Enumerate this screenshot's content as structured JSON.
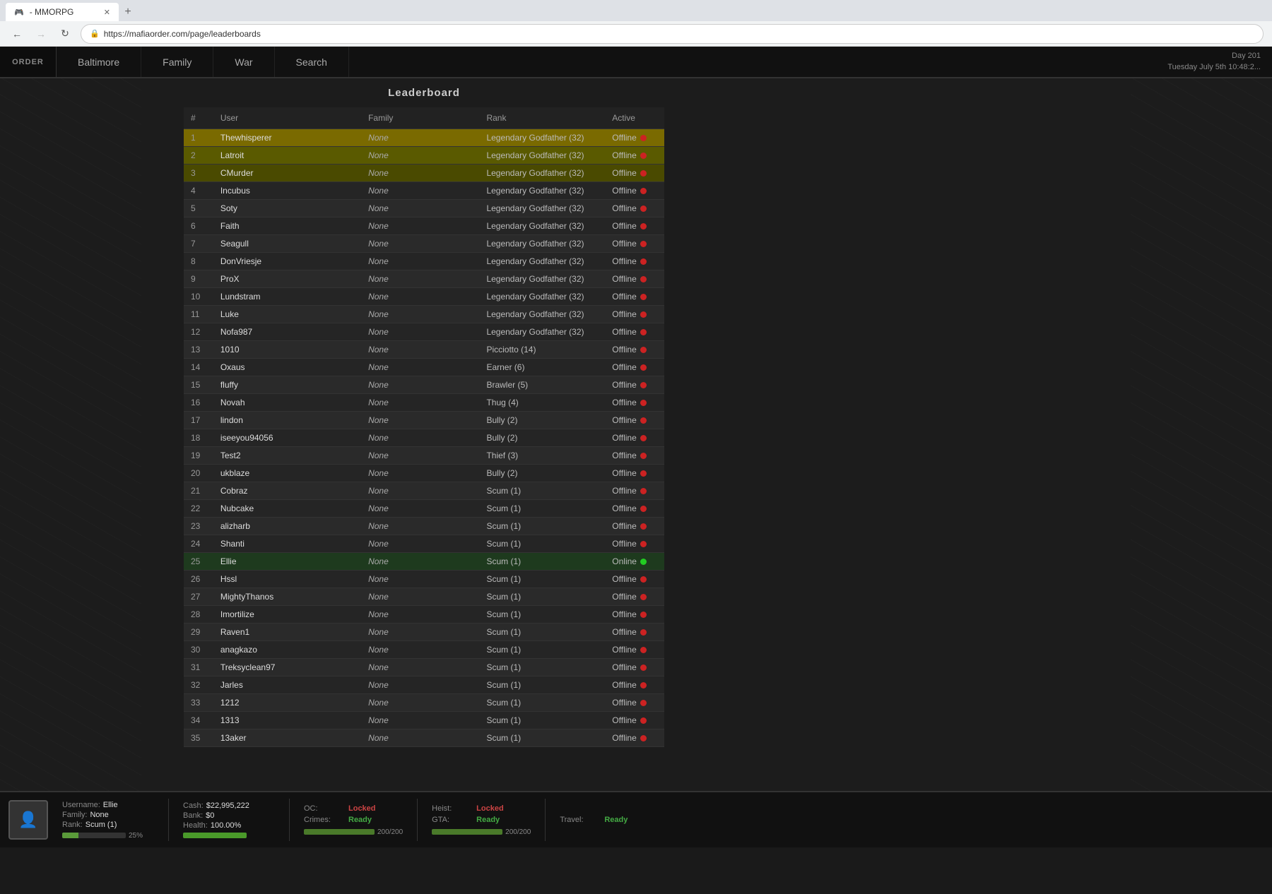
{
  "browser": {
    "tab_title": "- MMORPG",
    "url": "https://mafiaorder.com/page/leaderboards"
  },
  "navbar": {
    "logo": "ORDER",
    "items": [
      "Baltimore",
      "Family",
      "War",
      "Search"
    ],
    "datetime_line1": "Day 201",
    "datetime_line2": "Tuesday July 5th 10:48:2..."
  },
  "leaderboard": {
    "title": "Leaderboard",
    "columns": [
      "#",
      "User",
      "Family",
      "Rank",
      "Active"
    ],
    "rows": [
      {
        "pos": 1,
        "user": "Thewhisperer",
        "family": "None",
        "rank": "Legendary Godfather (32)",
        "active": "Offline",
        "online": false,
        "css_class": "rank-1"
      },
      {
        "pos": 2,
        "user": "Latroit",
        "family": "None",
        "rank": "Legendary Godfather (32)",
        "active": "Offline",
        "online": false,
        "css_class": "rank-2"
      },
      {
        "pos": 3,
        "user": "CMurder",
        "family": "None",
        "rank": "Legendary Godfather (32)",
        "active": "Offline",
        "online": false,
        "css_class": "rank-3"
      },
      {
        "pos": 4,
        "user": "Incubus",
        "family": "None",
        "rank": "Legendary Godfather (32)",
        "active": "Offline",
        "online": false,
        "css_class": ""
      },
      {
        "pos": 5,
        "user": "Soty",
        "family": "None",
        "rank": "Legendary Godfather (32)",
        "active": "Offline",
        "online": false,
        "css_class": ""
      },
      {
        "pos": 6,
        "user": "Faith",
        "family": "None",
        "rank": "Legendary Godfather (32)",
        "active": "Offline",
        "online": false,
        "css_class": ""
      },
      {
        "pos": 7,
        "user": "Seagull",
        "family": "None",
        "rank": "Legendary Godfather (32)",
        "active": "Offline",
        "online": false,
        "css_class": ""
      },
      {
        "pos": 8,
        "user": "DonVriesje",
        "family": "None",
        "rank": "Legendary Godfather (32)",
        "active": "Offline",
        "online": false,
        "css_class": ""
      },
      {
        "pos": 9,
        "user": "ProX",
        "family": "None",
        "rank": "Legendary Godfather (32)",
        "active": "Offline",
        "online": false,
        "css_class": ""
      },
      {
        "pos": 10,
        "user": "Lundstram",
        "family": "None",
        "rank": "Legendary Godfather (32)",
        "active": "Offline",
        "online": false,
        "css_class": ""
      },
      {
        "pos": 11,
        "user": "Luke",
        "family": "None",
        "rank": "Legendary Godfather (32)",
        "active": "Offline",
        "online": false,
        "css_class": ""
      },
      {
        "pos": 12,
        "user": "Nofa987",
        "family": "None",
        "rank": "Legendary Godfather (32)",
        "active": "Offline",
        "online": false,
        "css_class": ""
      },
      {
        "pos": 13,
        "user": "1010",
        "family": "None",
        "rank": "Picciotto (14)",
        "active": "Offline",
        "online": false,
        "css_class": ""
      },
      {
        "pos": 14,
        "user": "Oxaus",
        "family": "None",
        "rank": "Earner (6)",
        "active": "Offline",
        "online": false,
        "css_class": ""
      },
      {
        "pos": 15,
        "user": "fluffy",
        "family": "None",
        "rank": "Brawler (5)",
        "active": "Offline",
        "online": false,
        "css_class": ""
      },
      {
        "pos": 16,
        "user": "Novah",
        "family": "None",
        "rank": "Thug (4)",
        "active": "Offline",
        "online": false,
        "css_class": ""
      },
      {
        "pos": 17,
        "user": "lindon",
        "family": "None",
        "rank": "Bully (2)",
        "active": "Offline",
        "online": false,
        "css_class": ""
      },
      {
        "pos": 18,
        "user": "iseeyou94056",
        "family": "None",
        "rank": "Bully (2)",
        "active": "Offline",
        "online": false,
        "css_class": ""
      },
      {
        "pos": 19,
        "user": "Test2",
        "family": "None",
        "rank": "Thief (3)",
        "active": "Offline",
        "online": false,
        "css_class": ""
      },
      {
        "pos": 20,
        "user": "ukblaze",
        "family": "None",
        "rank": "Bully (2)",
        "active": "Offline",
        "online": false,
        "css_class": ""
      },
      {
        "pos": 21,
        "user": "Cobraz",
        "family": "None",
        "rank": "Scum (1)",
        "active": "Offline",
        "online": false,
        "css_class": ""
      },
      {
        "pos": 22,
        "user": "Nubcake",
        "family": "None",
        "rank": "Scum (1)",
        "active": "Offline",
        "online": false,
        "css_class": ""
      },
      {
        "pos": 23,
        "user": "alizharb",
        "family": "None",
        "rank": "Scum (1)",
        "active": "Offline",
        "online": false,
        "css_class": ""
      },
      {
        "pos": 24,
        "user": "Shanti",
        "family": "None",
        "rank": "Scum (1)",
        "active": "Offline",
        "online": false,
        "css_class": ""
      },
      {
        "pos": 25,
        "user": "Ellie",
        "family": "None",
        "rank": "Scum (1)",
        "active": "Online",
        "online": true,
        "css_class": "highlight-row"
      },
      {
        "pos": 26,
        "user": "Hssl",
        "family": "None",
        "rank": "Scum (1)",
        "active": "Offline",
        "online": false,
        "css_class": ""
      },
      {
        "pos": 27,
        "user": "MightyThanos",
        "family": "None",
        "rank": "Scum (1)",
        "active": "Offline",
        "online": false,
        "css_class": ""
      },
      {
        "pos": 28,
        "user": "Imortilize",
        "family": "None",
        "rank": "Scum (1)",
        "active": "Offline",
        "online": false,
        "css_class": ""
      },
      {
        "pos": 29,
        "user": "Raven1",
        "family": "None",
        "rank": "Scum (1)",
        "active": "Offline",
        "online": false,
        "css_class": ""
      },
      {
        "pos": 30,
        "user": "anagkazo",
        "family": "None",
        "rank": "Scum (1)",
        "active": "Offline",
        "online": false,
        "css_class": ""
      },
      {
        "pos": 31,
        "user": "Treksyclean97",
        "family": "None",
        "rank": "Scum (1)",
        "active": "Offline",
        "online": false,
        "css_class": ""
      },
      {
        "pos": 32,
        "user": "Jarles",
        "family": "None",
        "rank": "Scum (1)",
        "active": "Offline",
        "online": false,
        "css_class": ""
      },
      {
        "pos": 33,
        "user": "1212",
        "family": "None",
        "rank": "Scum (1)",
        "active": "Offline",
        "online": false,
        "css_class": ""
      },
      {
        "pos": 34,
        "user": "1313",
        "family": "None",
        "rank": "Scum (1)",
        "active": "Offline",
        "online": false,
        "css_class": ""
      },
      {
        "pos": 35,
        "user": "13aker",
        "family": "None",
        "rank": "Scum (1)",
        "active": "Offline",
        "online": false,
        "css_class": ""
      }
    ]
  },
  "hud": {
    "username_label": "Username:",
    "username_value": "Ellie",
    "family_label": "Family:",
    "family_value": "None",
    "rank_label": "Rank:",
    "rank_value": "Scum (1)",
    "xp_percent": 25,
    "xp_label": "25%",
    "cash_label": "Cash:",
    "cash_value": "$22,995,222",
    "bank_label": "Bank:",
    "bank_value": "$0",
    "health_label": "Health:",
    "health_value": "100.00%",
    "health_bar": 100,
    "oc_label": "OC:",
    "oc_value": "Locked",
    "heist_label": "Heist:",
    "heist_value": "Locked",
    "travel_label": "Travel:",
    "travel_value": "Ready",
    "crimes_label": "Crimes:",
    "crimes_value": "Ready",
    "crimes_bar_current": 200,
    "crimes_bar_max": 200,
    "gta_label": "GTA:",
    "gta_value": "Ready",
    "gta_bar_current": 200,
    "gta_bar_max": 200,
    "crimes_bar_text": "200/200",
    "gta_bar_text": "200/200"
  }
}
